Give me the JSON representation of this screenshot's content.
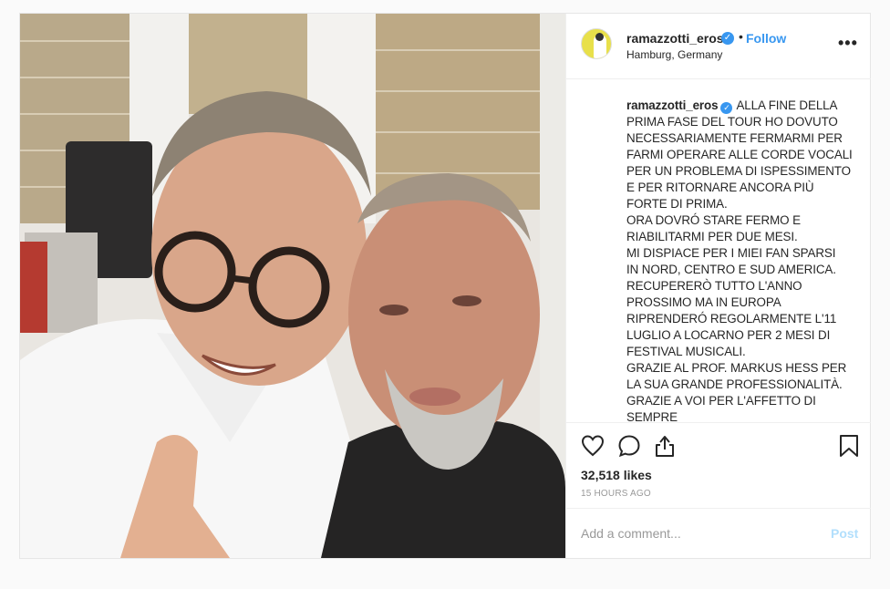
{
  "post": {
    "username": "ramazzotti_eros",
    "separator": "•",
    "follow_label": "Follow",
    "location": "Hamburg, Germany",
    "more_label": "•••",
    "verified_glyph": "✓",
    "caption_lines": [
      "ALLA FINE DELLA",
      "PRIMA FASE DEL TOUR HO DOVUTO",
      "NECESSARIAMENTE FERMARMI PER",
      "FARMI OPERARE ALLE CORDE VOCALI",
      "PER UN PROBLEMA DI ISPESSIMENTO",
      "E PER RITORNARE ANCORA PIÙ",
      "FORTE DI PRIMA.",
      "ORA DOVRÓ STARE FERMO E",
      "RIABILITARMI PER DUE MESI.",
      "MI DISPIACE PER I MIEI FAN SPARSI",
      "IN NORD, CENTRO E SUD AMERICA.",
      "RECUPERERÒ TUTTO L'ANNO",
      "PROSSIMO MA IN EUROPA",
      "RIPRENDERÓ REGOLARMENTE L'11",
      "LUGLIO A LOCARNO PER 2 MESI DI",
      "FESTIVAL MUSICALI.",
      "GRAZIE AL PROF. MARKUS HESS PER",
      "LA SUA GRANDE PROFESSIONALITÀ.",
      "GRAZIE A VOI PER L'AFFETTO DI",
      "SEMPRE"
    ],
    "likes": "32,518 likes",
    "time_ago": "15 HOURS AGO",
    "comment_placeholder": "Add a comment...",
    "post_label": "Post"
  },
  "icons": {
    "like": "heart-icon",
    "comment": "comment-bubble-icon",
    "share": "share-icon",
    "save": "bookmark-icon"
  },
  "colors": {
    "link_blue": "#3897f0",
    "post_disabled": "#b2dffc",
    "avatar_bg": "#e8e04a"
  }
}
